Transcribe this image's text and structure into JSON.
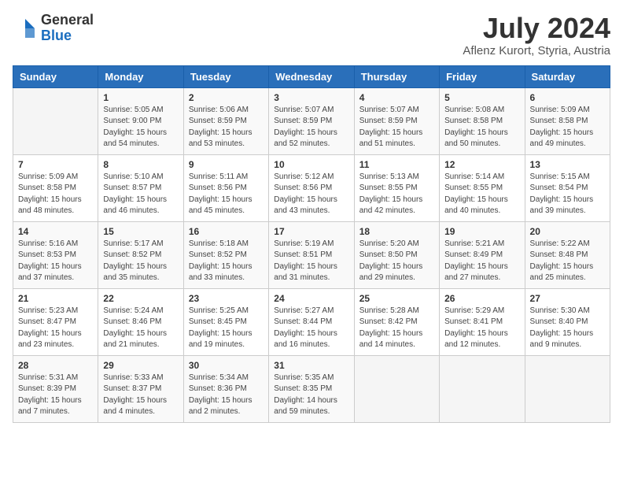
{
  "header": {
    "logo_general": "General",
    "logo_blue": "Blue",
    "month_year": "July 2024",
    "location": "Aflenz Kurort, Styria, Austria"
  },
  "weekdays": [
    "Sunday",
    "Monday",
    "Tuesday",
    "Wednesday",
    "Thursday",
    "Friday",
    "Saturday"
  ],
  "weeks": [
    [
      {
        "day": "",
        "info": ""
      },
      {
        "day": "1",
        "info": "Sunrise: 5:05 AM\nSunset: 9:00 PM\nDaylight: 15 hours\nand 54 minutes."
      },
      {
        "day": "2",
        "info": "Sunrise: 5:06 AM\nSunset: 8:59 PM\nDaylight: 15 hours\nand 53 minutes."
      },
      {
        "day": "3",
        "info": "Sunrise: 5:07 AM\nSunset: 8:59 PM\nDaylight: 15 hours\nand 52 minutes."
      },
      {
        "day": "4",
        "info": "Sunrise: 5:07 AM\nSunset: 8:59 PM\nDaylight: 15 hours\nand 51 minutes."
      },
      {
        "day": "5",
        "info": "Sunrise: 5:08 AM\nSunset: 8:58 PM\nDaylight: 15 hours\nand 50 minutes."
      },
      {
        "day": "6",
        "info": "Sunrise: 5:09 AM\nSunset: 8:58 PM\nDaylight: 15 hours\nand 49 minutes."
      }
    ],
    [
      {
        "day": "7",
        "info": "Sunrise: 5:09 AM\nSunset: 8:58 PM\nDaylight: 15 hours\nand 48 minutes."
      },
      {
        "day": "8",
        "info": "Sunrise: 5:10 AM\nSunset: 8:57 PM\nDaylight: 15 hours\nand 46 minutes."
      },
      {
        "day": "9",
        "info": "Sunrise: 5:11 AM\nSunset: 8:56 PM\nDaylight: 15 hours\nand 45 minutes."
      },
      {
        "day": "10",
        "info": "Sunrise: 5:12 AM\nSunset: 8:56 PM\nDaylight: 15 hours\nand 43 minutes."
      },
      {
        "day": "11",
        "info": "Sunrise: 5:13 AM\nSunset: 8:55 PM\nDaylight: 15 hours\nand 42 minutes."
      },
      {
        "day": "12",
        "info": "Sunrise: 5:14 AM\nSunset: 8:55 PM\nDaylight: 15 hours\nand 40 minutes."
      },
      {
        "day": "13",
        "info": "Sunrise: 5:15 AM\nSunset: 8:54 PM\nDaylight: 15 hours\nand 39 minutes."
      }
    ],
    [
      {
        "day": "14",
        "info": "Sunrise: 5:16 AM\nSunset: 8:53 PM\nDaylight: 15 hours\nand 37 minutes."
      },
      {
        "day": "15",
        "info": "Sunrise: 5:17 AM\nSunset: 8:52 PM\nDaylight: 15 hours\nand 35 minutes."
      },
      {
        "day": "16",
        "info": "Sunrise: 5:18 AM\nSunset: 8:52 PM\nDaylight: 15 hours\nand 33 minutes."
      },
      {
        "day": "17",
        "info": "Sunrise: 5:19 AM\nSunset: 8:51 PM\nDaylight: 15 hours\nand 31 minutes."
      },
      {
        "day": "18",
        "info": "Sunrise: 5:20 AM\nSunset: 8:50 PM\nDaylight: 15 hours\nand 29 minutes."
      },
      {
        "day": "19",
        "info": "Sunrise: 5:21 AM\nSunset: 8:49 PM\nDaylight: 15 hours\nand 27 minutes."
      },
      {
        "day": "20",
        "info": "Sunrise: 5:22 AM\nSunset: 8:48 PM\nDaylight: 15 hours\nand 25 minutes."
      }
    ],
    [
      {
        "day": "21",
        "info": "Sunrise: 5:23 AM\nSunset: 8:47 PM\nDaylight: 15 hours\nand 23 minutes."
      },
      {
        "day": "22",
        "info": "Sunrise: 5:24 AM\nSunset: 8:46 PM\nDaylight: 15 hours\nand 21 minutes."
      },
      {
        "day": "23",
        "info": "Sunrise: 5:25 AM\nSunset: 8:45 PM\nDaylight: 15 hours\nand 19 minutes."
      },
      {
        "day": "24",
        "info": "Sunrise: 5:27 AM\nSunset: 8:44 PM\nDaylight: 15 hours\nand 16 minutes."
      },
      {
        "day": "25",
        "info": "Sunrise: 5:28 AM\nSunset: 8:42 PM\nDaylight: 15 hours\nand 14 minutes."
      },
      {
        "day": "26",
        "info": "Sunrise: 5:29 AM\nSunset: 8:41 PM\nDaylight: 15 hours\nand 12 minutes."
      },
      {
        "day": "27",
        "info": "Sunrise: 5:30 AM\nSunset: 8:40 PM\nDaylight: 15 hours\nand 9 minutes."
      }
    ],
    [
      {
        "day": "28",
        "info": "Sunrise: 5:31 AM\nSunset: 8:39 PM\nDaylight: 15 hours\nand 7 minutes."
      },
      {
        "day": "29",
        "info": "Sunrise: 5:33 AM\nSunset: 8:37 PM\nDaylight: 15 hours\nand 4 minutes."
      },
      {
        "day": "30",
        "info": "Sunrise: 5:34 AM\nSunset: 8:36 PM\nDaylight: 15 hours\nand 2 minutes."
      },
      {
        "day": "31",
        "info": "Sunrise: 5:35 AM\nSunset: 8:35 PM\nDaylight: 14 hours\nand 59 minutes."
      },
      {
        "day": "",
        "info": ""
      },
      {
        "day": "",
        "info": ""
      },
      {
        "day": "",
        "info": ""
      }
    ]
  ]
}
